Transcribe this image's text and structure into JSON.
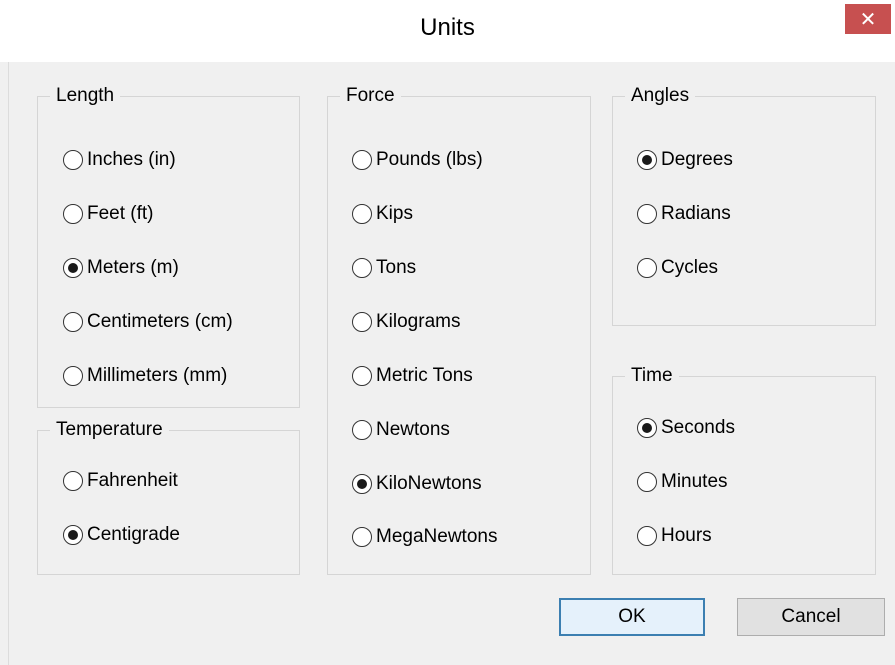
{
  "window": {
    "title": "Units",
    "close_label": "✕"
  },
  "groups": {
    "length": {
      "legend": "Length",
      "options": [
        "Inches (in)",
        "Feet (ft)",
        "Meters (m)",
        "Centimeters (cm)",
        "Millimeters (mm)"
      ],
      "selected": "Meters (m)"
    },
    "temperature": {
      "legend": "Temperature",
      "options": [
        "Fahrenheit",
        "Centigrade"
      ],
      "selected": "Centigrade"
    },
    "force": {
      "legend": "Force",
      "options": [
        "Pounds (lbs)",
        "Kips",
        "Tons",
        "Kilograms",
        "Metric Tons",
        "Newtons",
        "KiloNewtons",
        "MegaNewtons"
      ],
      "selected": "KiloNewtons"
    },
    "angles": {
      "legend": "Angles",
      "options": [
        "Degrees",
        "Radians",
        "Cycles"
      ],
      "selected": "Degrees"
    },
    "time": {
      "legend": "Time",
      "options": [
        "Seconds",
        "Minutes",
        "Hours"
      ],
      "selected": "Seconds"
    }
  },
  "buttons": {
    "ok": "OK",
    "cancel": "Cancel"
  }
}
